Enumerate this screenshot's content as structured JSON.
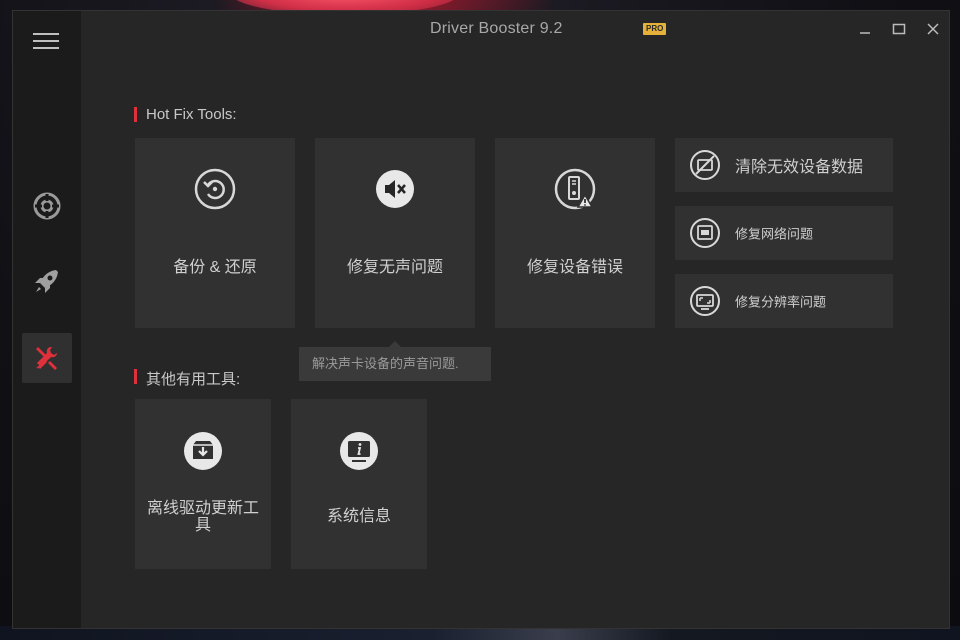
{
  "window": {
    "title": "Driver Booster 9.2",
    "badge": "PRO",
    "accent_color": "#e0303c",
    "badge_color": "#e6b13a"
  },
  "sidebar": {
    "items": [
      {
        "icon": "menu-icon"
      },
      {
        "icon": "lifebuoy-icon"
      },
      {
        "icon": "rocket-icon"
      },
      {
        "icon": "tools-icon",
        "active": true
      }
    ]
  },
  "hotfix": {
    "section_label": "Hot Fix Tools:",
    "tiles": [
      {
        "label": "备份 & 还原",
        "icon": "backup-restore-icon"
      },
      {
        "label": "修复无声问题",
        "icon": "speaker-mute-icon"
      },
      {
        "label": "修复设备错误",
        "icon": "device-error-icon"
      }
    ],
    "small_tiles": [
      {
        "label": "清除无效设备数据",
        "icon": "clear-device-data-icon"
      },
      {
        "label": "修复网络问题",
        "icon": "network-icon"
      },
      {
        "label": "修复分辨率问题",
        "icon": "resolution-icon"
      }
    ]
  },
  "tooltip": {
    "text": "解决声卡设备的声音问题."
  },
  "other": {
    "section_label": "其他有用工具:",
    "tiles": [
      {
        "label": "离线驱动更新工具",
        "icon": "offline-update-icon"
      },
      {
        "label": "系统信息",
        "icon": "system-info-icon"
      }
    ]
  }
}
